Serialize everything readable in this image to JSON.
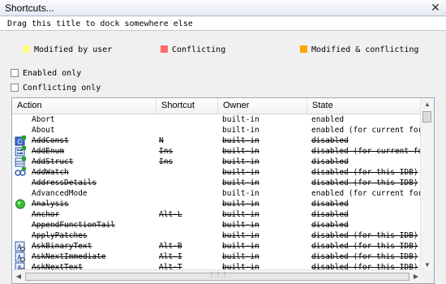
{
  "window": {
    "title": "Shortcuts...",
    "close_glyph": "✕"
  },
  "dock_hint": "Drag this title to dock somewhere else",
  "legend": [
    {
      "label": "Modified by user",
      "color": "#ffff88"
    },
    {
      "label": "Conflicting",
      "color": "#ff6b6b"
    },
    {
      "label": "Modified & conflicting",
      "color": "#ffa500"
    }
  ],
  "filters": {
    "enabled_only": {
      "label": "Enabled only",
      "checked": false
    },
    "conflicting_only": {
      "label": "Conflicting only",
      "checked": false
    }
  },
  "table": {
    "columns": [
      "Action",
      "Shortcut",
      "Owner",
      "State"
    ],
    "rows": [
      {
        "action": "Abort",
        "shortcut": "",
        "owner": "built-in",
        "state": "enabled",
        "struck": false,
        "icon": ""
      },
      {
        "action": "About",
        "shortcut": "",
        "owner": "built-in",
        "state": "enabled (for current form)",
        "struck": false,
        "icon": ""
      },
      {
        "action": "AddConst",
        "shortcut": "N",
        "owner": "built-in",
        "state": "disabled",
        "struck": true,
        "icon": "add-const-icon"
      },
      {
        "action": "AddEnum",
        "shortcut": "Ins",
        "owner": "built-in",
        "state": "disabled (for current form)",
        "struck": true,
        "icon": "add-enum-icon"
      },
      {
        "action": "AddStruct",
        "shortcut": "Ins",
        "owner": "built-in",
        "state": "disabled",
        "struck": true,
        "icon": "add-struct-icon"
      },
      {
        "action": "AddWatch",
        "shortcut": "",
        "owner": "built-in",
        "state": "disabled (for this IDB)",
        "struck": true,
        "icon": "add-watch-icon"
      },
      {
        "action": "AddressDetails",
        "shortcut": "",
        "owner": "built-in",
        "state": "disabled (for this IDB)",
        "struck": true,
        "icon": ""
      },
      {
        "action": "AdvancedMode",
        "shortcut": "",
        "owner": "built-in",
        "state": "enabled (for current form)",
        "struck": false,
        "icon": ""
      },
      {
        "action": "Analysis",
        "shortcut": "",
        "owner": "built-in",
        "state": "disabled",
        "struck": true,
        "icon": "analysis-icon"
      },
      {
        "action": "Anchor",
        "shortcut": "Alt-L",
        "owner": "built-in",
        "state": "disabled",
        "struck": true,
        "icon": ""
      },
      {
        "action": "AppendFunctionTail",
        "shortcut": "",
        "owner": "built-in",
        "state": "disabled",
        "struck": true,
        "icon": ""
      },
      {
        "action": "ApplyPatches",
        "shortcut": "",
        "owner": "built-in",
        "state": "disabled (for this IDB)",
        "struck": true,
        "icon": ""
      },
      {
        "action": "AskBinaryText",
        "shortcut": "Alt-B",
        "owner": "built-in",
        "state": "disabled (for this IDB)",
        "struck": true,
        "icon": "ask-binary-text-icon"
      },
      {
        "action": "AskNextImmediate",
        "shortcut": "Alt-I",
        "owner": "built-in",
        "state": "disabled (for this IDB)",
        "struck": true,
        "icon": "ask-next-immediate-icon"
      },
      {
        "action": "AskNextText",
        "shortcut": "Alt-T",
        "owner": "built-in",
        "state": "disabled (for this IDB)",
        "struck": true,
        "icon": "ask-next-text-icon"
      }
    ]
  },
  "scroll_glyphs": {
    "up": "▲",
    "down": "▼",
    "left": "◀",
    "right": "▶",
    "grip": "⋮⋮⋮"
  }
}
